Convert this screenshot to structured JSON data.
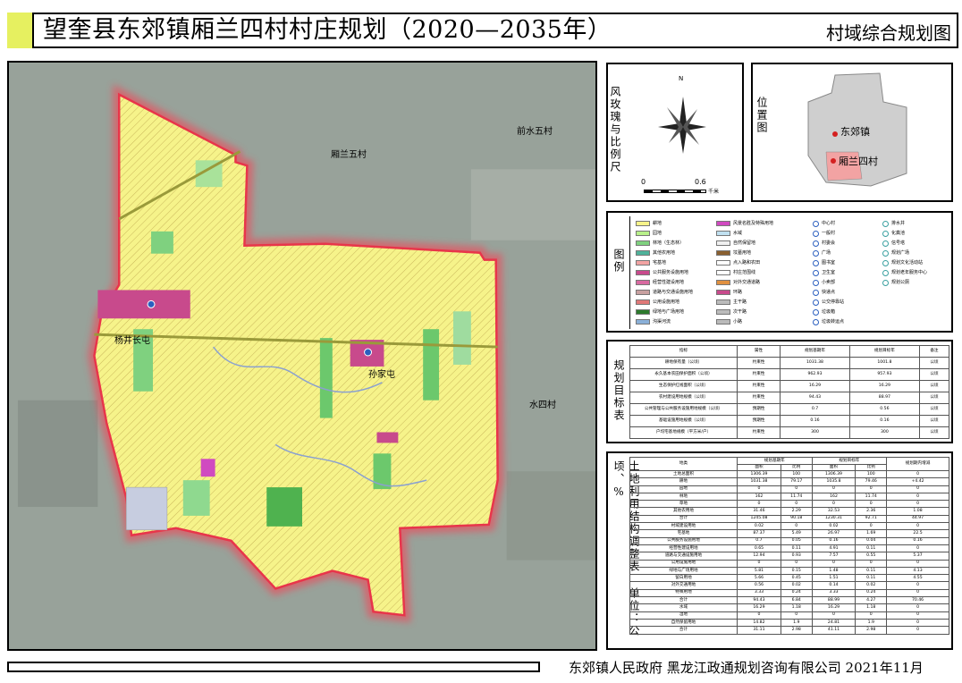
{
  "header": {
    "title": "望奎县东郊镇厢兰四村村庄规划（2020—2035年）",
    "map_type": "村域综合规划图"
  },
  "map": {
    "labels": {
      "neighbor_north": "厢兰五村",
      "neighbor_northeast": "前水五村",
      "neighbor_east": "水四村",
      "settlement_west": "杨井长屯",
      "settlement_center": "孙家屯"
    },
    "colors": {
      "background": "#9aa49c",
      "farmland": "#f6f38a",
      "village_boundary": "#e8354a",
      "construction": "#c84a8c",
      "green": "#7fd17f",
      "road": "#9a9a3a"
    }
  },
  "rose_panel": {
    "title": "风玫瑰与比例尺",
    "north": "N",
    "scale_start": "0",
    "scale_end": "0.6",
    "scale_unit": "千米"
  },
  "location_panel": {
    "title": "位置图",
    "town": "东郊镇",
    "village": "厢兰四村"
  },
  "legend_panel": {
    "title": "图例",
    "col1": [
      "耕地",
      "园地",
      "林地（生态林）",
      "其他农用地",
      "宅基地",
      "公共服务设施用地",
      "经营性建设用地",
      "道路与交通设施用地",
      "公用设施用地",
      "绿地与广场用地",
      "沟渠河流"
    ],
    "col2": [
      "风景名胜及特殊用地",
      "水域",
      "自然保留地",
      "坟墓用地",
      "点入路和农田",
      "村庄范围线",
      "对外交通道路",
      "环路",
      "主干路",
      "次干路",
      "小路"
    ],
    "col3": [
      "中心村",
      "一般村",
      "村委会",
      "广场",
      "图书室",
      "卫生室",
      "小卖部",
      "快递点",
      "公交停靠站",
      "垃圾箱",
      "垃圾转运点"
    ],
    "col4": [
      "排水井",
      "化粪池",
      "信号塔",
      "规划广场",
      "规划文化活动站",
      "规划老年服务中心",
      "规划公厕"
    ]
  },
  "targets_panel": {
    "title": "规划目标表",
    "headers": [
      "指标",
      "属性",
      "规划基期年",
      "规划目标年",
      "备注"
    ],
    "rows": [
      [
        "耕地保有量（公顷）",
        "约束性",
        "1031.38",
        "1001.8",
        "公顷"
      ],
      [
        "永久基本农田保护面积（公顷）",
        "约束性",
        "962.93",
        "957.93",
        "公顷"
      ],
      [
        "生态保护红线面积（公顷）",
        "约束性",
        "16.29",
        "16.29",
        "公顷"
      ],
      [
        "农村建设用地规模（公顷）",
        "约束性",
        "94.43",
        "88.97",
        "公顷"
      ],
      [
        "公共管理与公共服务设施用地规模（公顷）",
        "预期性",
        "0.7",
        "0.56",
        "公顷"
      ],
      [
        "基础设施用地规模（公顷）",
        "预期性",
        "0.16",
        "0.16",
        "公顷"
      ],
      [
        "户均宅基地规模（平方米/户）",
        "约束性",
        "300",
        "300",
        "公顷"
      ]
    ]
  },
  "landuse_panel": {
    "title": "土地利用结构调整表 单位：公顷、%",
    "headers": [
      "地类",
      "规划基期年",
      "规划目标年",
      "规划期内增减"
    ],
    "subheaders": [
      "面积",
      "比例",
      "面积",
      "比例"
    ],
    "rows": [
      [
        "土地总面积",
        "1306.39",
        "100",
        "1306.39",
        "100",
        "0"
      ],
      [
        "耕地",
        "1031.38",
        "79.17",
        "1035.8",
        "79.46",
        "+4.42"
      ],
      [
        "园地",
        "0",
        "0",
        "0",
        "0",
        "0"
      ],
      [
        "林地",
        "162",
        "11.74",
        "162",
        "11.74",
        "0"
      ],
      [
        "草地",
        "0",
        "0",
        "0",
        "0",
        "0"
      ],
      [
        "其他农用地",
        "31.46",
        "2.29",
        "32.53",
        "2.36",
        "1.08"
      ],
      [
        "合计",
        "1245.08",
        "90.18",
        "1230.31",
        "92.71",
        "44.97"
      ],
      [
        "村域建设用地",
        "0.02",
        "0",
        "0.02",
        "0",
        "0"
      ],
      [
        "宅基地",
        "87.37",
        "5.49",
        "26.97",
        "1.69",
        "22.5"
      ],
      [
        "公共服务设施用地",
        "0.7",
        "0.05",
        "0.16",
        "0.04",
        "0.16"
      ],
      [
        "经营性建设用地",
        "0.65",
        "0.11",
        "4.91",
        "0.11",
        "0"
      ],
      [
        "道路与交通设施用地",
        "12.94",
        "0.93",
        "7.57",
        "0.55",
        "5.37"
      ],
      [
        "公用设施用地",
        "0",
        "0",
        "0",
        "0",
        "0"
      ],
      [
        "绿地与广场用地",
        "5.81",
        "0.15",
        "1.48",
        "0.11",
        "4.13"
      ],
      [
        "留白用地",
        "5.66",
        "0.45",
        "1.51",
        "0.11",
        "4.55"
      ],
      [
        "对外交通用地",
        "0.56",
        "0.02",
        "0.14",
        "0.02",
        "0"
      ],
      [
        "特殊用地",
        "3.33",
        "0.24",
        "3.33",
        "0.24",
        "0"
      ],
      [
        "合计",
        "94.43",
        "6.84",
        "88.99",
        "4.27",
        "70.46"
      ],
      [
        "水域",
        "16.29",
        "1.18",
        "16.29",
        "1.18",
        "0"
      ],
      [
        "湿地",
        "0",
        "0",
        "0",
        "0",
        "0"
      ],
      [
        "自然保留用地",
        "14.82",
        "1.9",
        "24.81",
        "1.9",
        "0"
      ],
      [
        "合计",
        "31.11",
        "2.98",
        "41.11",
        "2.98",
        "0"
      ]
    ]
  },
  "footer": {
    "text": "东郊镇人民政府  黑龙江政通规划咨询有限公司  2021年11月"
  }
}
